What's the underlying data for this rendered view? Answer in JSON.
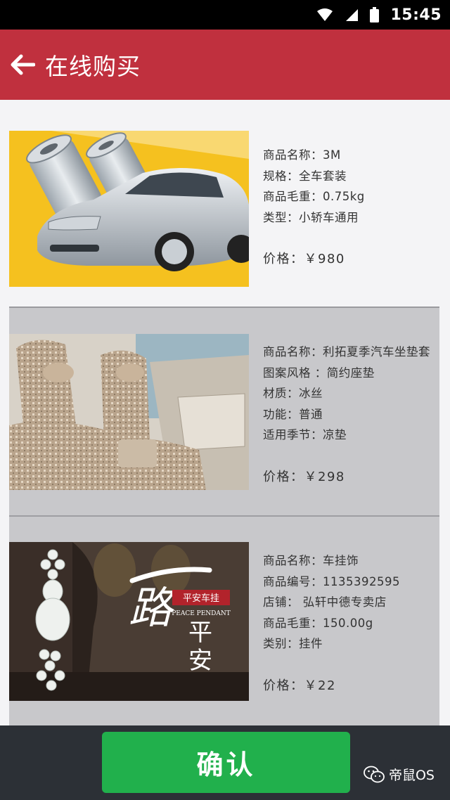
{
  "status_bar": {
    "time": "15:45"
  },
  "header": {
    "title": "在线购买"
  },
  "products": [
    {
      "rows": [
        "商品名称：3M",
        "规格：全车套装",
        "商品毛重：0.75kg",
        "类型：小轿车通用"
      ],
      "price": "价格：￥980"
    },
    {
      "rows": [
        "商品名称：利拓夏季汽车坐垫套",
        "图案风格 ：简约座垫",
        "材质：冰丝",
        "功能：普通",
        "适用季节：凉垫"
      ],
      "price": "价格：￥298"
    },
    {
      "rows": [
        "商品名称：车挂饰",
        "商品编号：1135392595",
        "店铺： 弘轩中德专卖店",
        "商品毛重：150.00g",
        "类别：挂件"
      ],
      "price": "价格：￥22",
      "image_text": {
        "big": "一路平安",
        "tag": "平安车挂",
        "sub": "PEACE PENDANT"
      }
    }
  ],
  "footer": {
    "confirm_label": "确认",
    "watermark": "帝鼠OS"
  },
  "colors": {
    "header": "#c0303e",
    "confirm": "#21b04c",
    "bottombar": "#2c3036",
    "list_gray": "#c8c8cb"
  }
}
